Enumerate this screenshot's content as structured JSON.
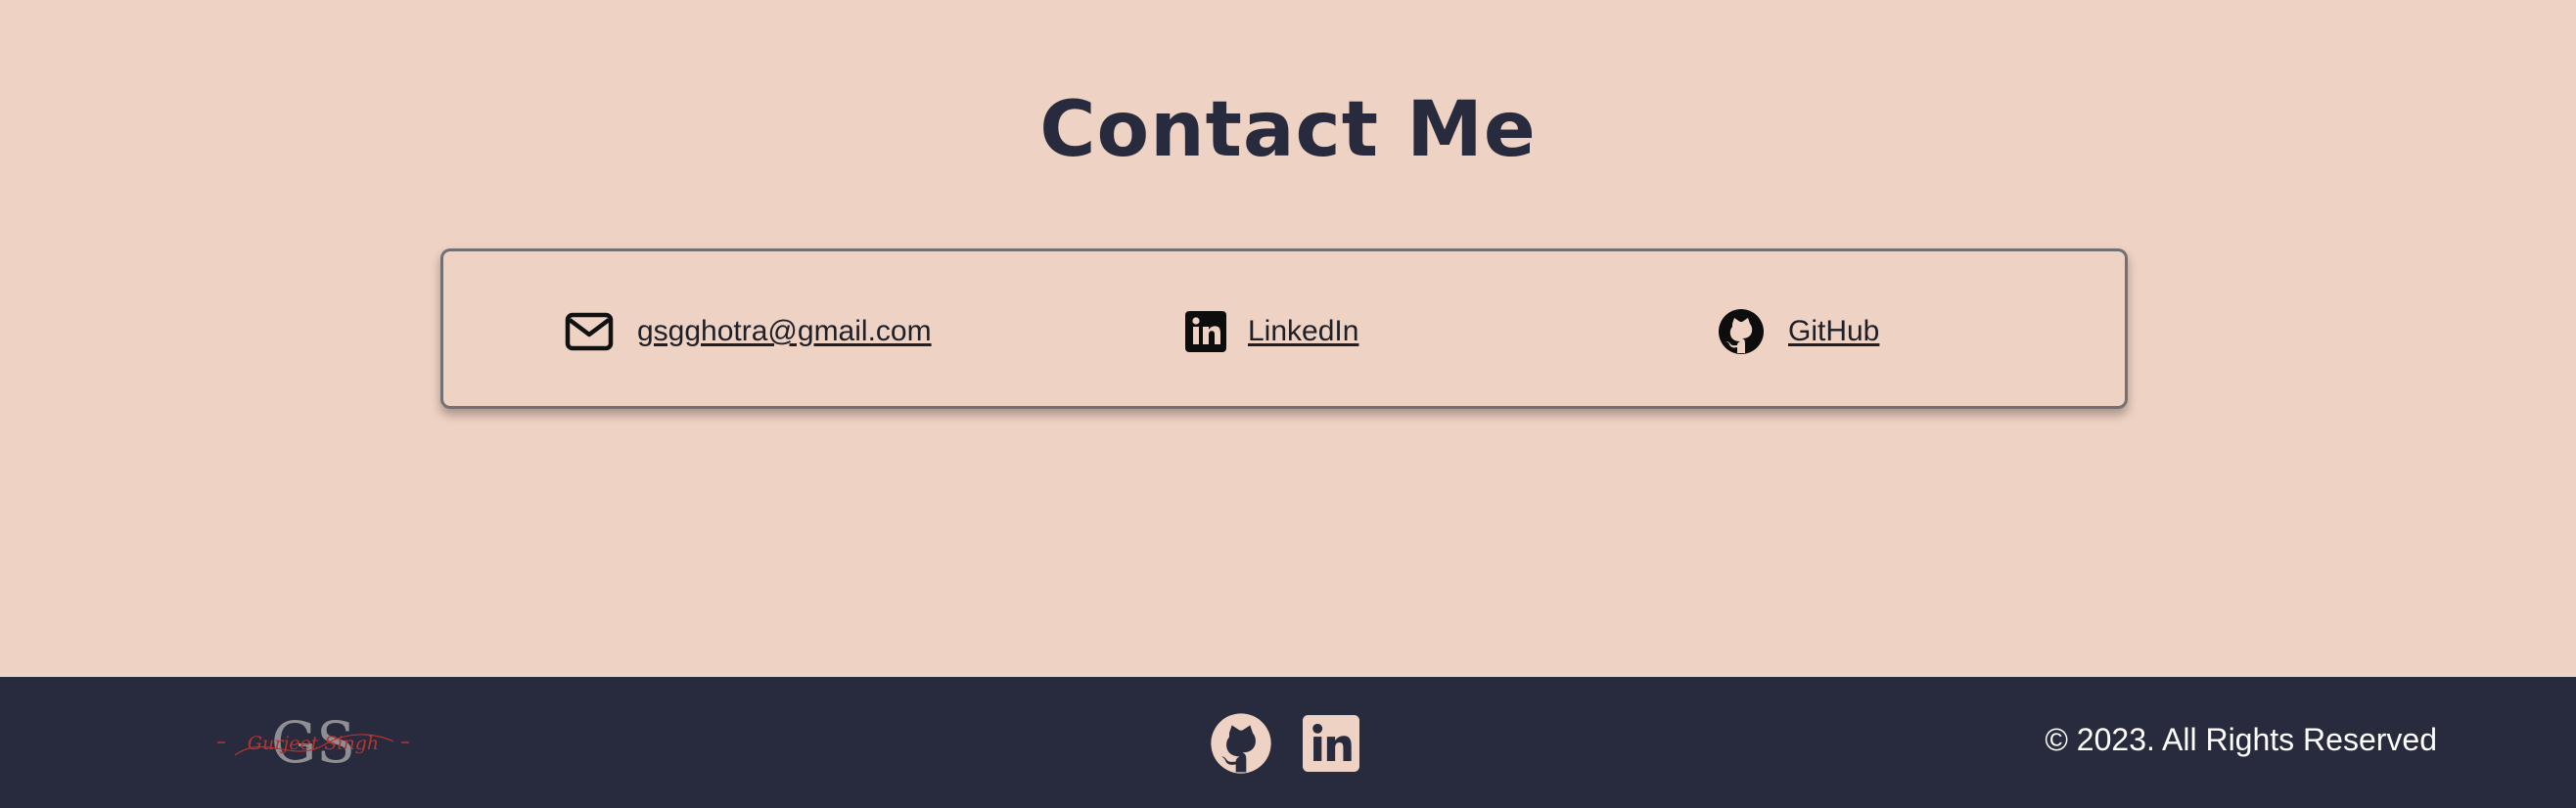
{
  "page": {
    "title": "Contact Me"
  },
  "contacts": [
    {
      "label": "gsgghotra@gmail.com",
      "icon": "envelope-icon"
    },
    {
      "label": "LinkedIn",
      "icon": "linkedin-icon"
    },
    {
      "label": "GitHub",
      "icon": "github-icon"
    }
  ],
  "footer": {
    "logo_text": "GS",
    "logo_script": "Gurjeet Singh",
    "social": [
      "github-icon",
      "linkedin-icon"
    ],
    "copyright": "© 2023. All Rights Reserved"
  },
  "colors": {
    "background": "#eed2c3",
    "footer": "#282a3e",
    "title": "#282a3e",
    "accent_red": "#b8342f"
  }
}
